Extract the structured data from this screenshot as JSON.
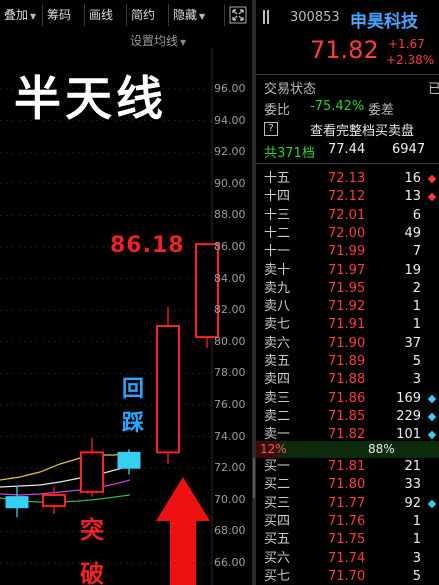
{
  "toolbar": {
    "overlay_label": "叠加",
    "chip_label": "筹码",
    "draw_label": "画线",
    "simple_label": "简约",
    "hide_label": "隐藏",
    "expand_icon": "expand-icon"
  },
  "chart": {
    "ma_setting_label": "设置均线",
    "title_text": "半天线",
    "high_label": "86.18",
    "pullback_text": "回踩",
    "breakout_text": "突破",
    "price_axis": [
      "96.00",
      "94.00",
      "92.00",
      "90.00",
      "88.00",
      "86.00",
      "84.00",
      "82.00",
      "80.00",
      "78.00",
      "76.00",
      "74.00",
      "72.00",
      "70.00",
      "68.00",
      "66.00"
    ],
    "colors": {
      "up": "#ff2020",
      "down": "#35d0f0",
      "ma_yellow": "#d8c83a",
      "ma_purple": "#c848d8",
      "ma_white": "#e6e6e6",
      "ma_green": "#2bb84a"
    }
  },
  "chart_data": {
    "type": "candlestick",
    "ylim": [
      65,
      97
    ],
    "candles": [
      {
        "open": 70.2,
        "close": 69.5,
        "high": 70.9,
        "low": 68.9,
        "dir": "down"
      },
      {
        "open": 69.6,
        "close": 70.3,
        "high": 70.8,
        "low": 69.1,
        "dir": "up"
      },
      {
        "open": 70.5,
        "close": 73.0,
        "high": 73.9,
        "low": 70.2,
        "dir": "up"
      },
      {
        "open": 72.0,
        "close": 73.0,
        "high": 73.2,
        "low": 71.6,
        "dir": "down"
      },
      {
        "open": 73.0,
        "close": 81.0,
        "high": 82.2,
        "low": 72.3,
        "dir": "up"
      },
      {
        "open": 80.3,
        "close": 86.18,
        "high": 86.18,
        "low": 79.6,
        "dir": "up"
      }
    ]
  },
  "stock": {
    "code": "300853",
    "name": "申昊科技",
    "last_price": "71.82",
    "change": "+1.67",
    "change_pct": "+2.38%",
    "menu_icon": "menu-icon"
  },
  "info": {
    "status_label": "交易状态",
    "status_value": "已",
    "wei_bi_label": "委比",
    "wei_bi_value": "-75.42%",
    "wei_cha_label": "委差",
    "help_icon": "?",
    "view_full_label": "查看完整档买卖盘",
    "total_label": "共371档",
    "total_price": "77.44",
    "total_vol": "6947"
  },
  "sell_orders": [
    {
      "label": "十五",
      "price": "72.13",
      "vol": "16",
      "mark": "red"
    },
    {
      "label": "十四",
      "price": "72.12",
      "vol": "13",
      "mark": "red"
    },
    {
      "label": "十三",
      "price": "72.01",
      "vol": "6",
      "mark": ""
    },
    {
      "label": "十二",
      "price": "72.00",
      "vol": "49",
      "mark": ""
    },
    {
      "label": "十一",
      "price": "71.99",
      "vol": "7",
      "mark": ""
    },
    {
      "label": "卖十",
      "price": "71.97",
      "vol": "19",
      "mark": ""
    },
    {
      "label": "卖九",
      "price": "71.95",
      "vol": "2",
      "mark": ""
    },
    {
      "label": "卖八",
      "price": "71.92",
      "vol": "1",
      "mark": ""
    },
    {
      "label": "卖七",
      "price": "71.91",
      "vol": "1",
      "mark": ""
    },
    {
      "label": "卖六",
      "price": "71.90",
      "vol": "37",
      "mark": ""
    },
    {
      "label": "卖五",
      "price": "71.89",
      "vol": "5",
      "mark": ""
    },
    {
      "label": "卖四",
      "price": "71.88",
      "vol": "3",
      "mark": ""
    },
    {
      "label": "卖三",
      "price": "71.86",
      "vol": "169",
      "mark": "cyan"
    },
    {
      "label": "卖二",
      "price": "71.85",
      "vol": "229",
      "mark": "cyan"
    },
    {
      "label": "卖一",
      "price": "71.82",
      "vol": "101",
      "mark": "cyan"
    }
  ],
  "ratio": {
    "left": "12%",
    "right": "88%"
  },
  "buy_orders": [
    {
      "label": "买一",
      "price": "71.81",
      "vol": "21",
      "mark": ""
    },
    {
      "label": "买二",
      "price": "71.80",
      "vol": "33",
      "mark": ""
    },
    {
      "label": "买三",
      "price": "71.77",
      "vol": "92",
      "mark": "cyan"
    },
    {
      "label": "买四",
      "price": "71.76",
      "vol": "1",
      "mark": ""
    },
    {
      "label": "买五",
      "price": "71.75",
      "vol": "1",
      "mark": ""
    },
    {
      "label": "买六",
      "price": "71.74",
      "vol": "3",
      "mark": ""
    },
    {
      "label": "买七",
      "price": "71.70",
      "vol": "5",
      "mark": ""
    }
  ]
}
